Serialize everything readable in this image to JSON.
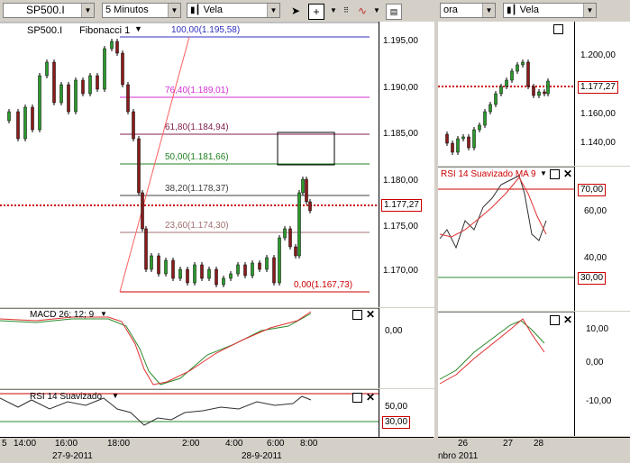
{
  "toolbar_left": {
    "symbol": "SP500.I",
    "interval": "5 Minutos",
    "chart_type": "Vela",
    "icons": [
      "candle-icon",
      "cursor-icon",
      "crosshair-icon",
      "drawing-icon",
      "settings-icon"
    ]
  },
  "toolbar_right": {
    "interval_partial": "ora",
    "chart_type": "Vela"
  },
  "main_chart": {
    "header_symbol": "SP500.I",
    "header_study": "Fibonacci 1",
    "fib_levels": [
      {
        "label": "100,00(1.195,58)",
        "color": "#3030c0"
      },
      {
        "label": "76,40(1.189,01)",
        "color": "#d030d0"
      },
      {
        "label": "61,80(1.184,94)",
        "color": "#802050"
      },
      {
        "label": "50,00(1.181,66)",
        "color": "#208020"
      },
      {
        "label": "38,20(1.178,37)",
        "color": "#404040"
      },
      {
        "label": "23,60(1.174,30)",
        "color": "#a07070"
      },
      {
        "label": "0,00(1.167,73)",
        "color": "#cc0000"
      }
    ],
    "price_axis": [
      "1.195,00",
      "1.190,00",
      "1.185,00",
      "1.180,00",
      "1.175,00",
      "1.170,00"
    ],
    "last_price": "1.177,27"
  },
  "macd_panel": {
    "title": "MACD 26; 12; 9",
    "axis": [
      "0,00"
    ]
  },
  "rsi_panel": {
    "title": "RSI 14 Suavizado",
    "axis": [
      "50,00"
    ],
    "level_tag": "30,00"
  },
  "time_axis": {
    "ticks": [
      "14:00",
      "16:00",
      "18:00",
      "2:00",
      "4:00",
      "6:00",
      "8:00"
    ],
    "dates": [
      "27-9-2011",
      "28-9-2011"
    ],
    "left_partial": "5"
  },
  "right_chart": {
    "price_axis": [
      "1.200,00",
      "1.160,00",
      "1.140,00"
    ],
    "last_price": "1.177,27",
    "rsi_title": "RSI 14 Suavizado MA 9",
    "rsi_tags": [
      "70,00",
      "30,00"
    ],
    "rsi_axis": [
      "60,00",
      "40,00"
    ],
    "macd_axis": [
      "10,00",
      "0,00",
      "-10,00"
    ],
    "time_ticks": [
      "26",
      "27",
      "28"
    ],
    "date_partial": "nbro 2011"
  }
}
